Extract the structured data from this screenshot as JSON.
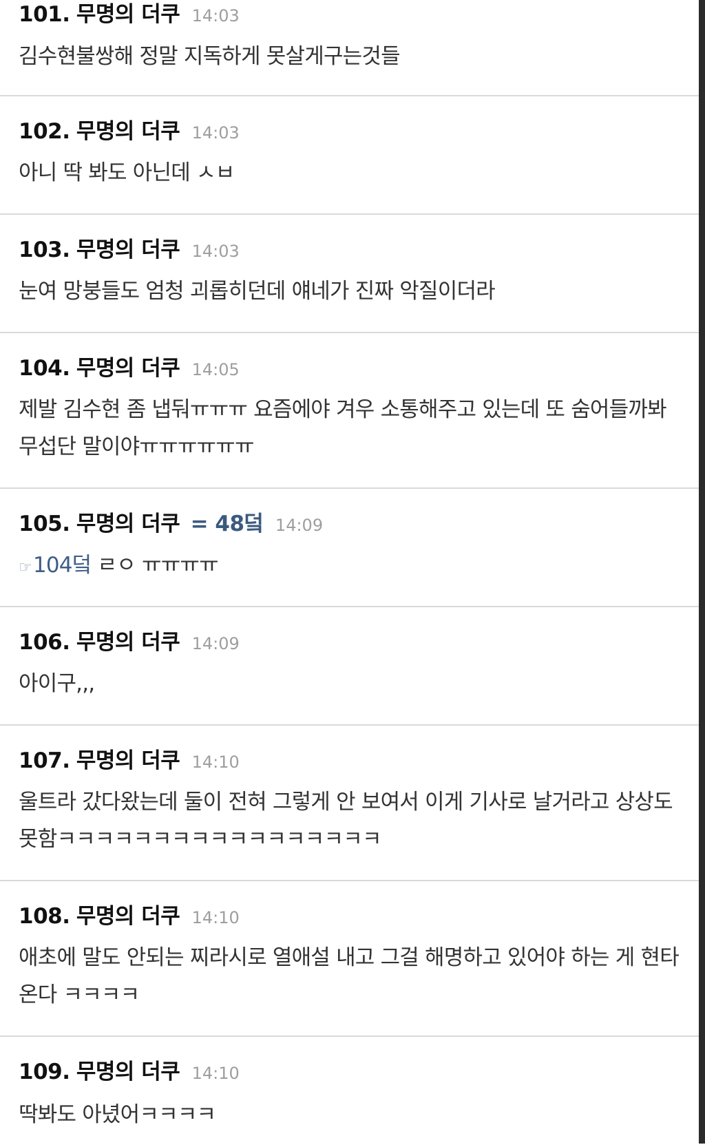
{
  "comments": [
    {
      "number": "101.",
      "author": "무명의 더쿠",
      "time": "14:03",
      "body": "김수현불쌍해 정말 지독하게 못살게구는것들"
    },
    {
      "number": "102.",
      "author": "무명의 더쿠",
      "time": "14:03",
      "body": "아니 딱 봐도 아닌데 ㅅㅂ"
    },
    {
      "number": "103.",
      "author": "무명의 더쿠",
      "time": "14:03",
      "body": "눈여 망붕들도 엄청 괴롭히던데 얘네가 진짜 악질이더라"
    },
    {
      "number": "104.",
      "author": "무명의 더쿠",
      "time": "14:05",
      "body": "제발 김수현 좀 냅둬ㅠㅠㅠ 요즘에야 겨우 소통해주고 있는데 또 숨어들까봐 무섭단 말이야ㅠㅠㅠㅠㅠㅠ"
    },
    {
      "number": "105.",
      "author": "무명의 더쿠",
      "author_tag": "= 48덬",
      "time": "14:09",
      "reply_hand": "☞",
      "reply_ref": "104덬",
      "body": " ㄹㅇ ㅠㅠㅠㅠ"
    },
    {
      "number": "106.",
      "author": "무명의 더쿠",
      "time": "14:09",
      "body": "아이구,,,"
    },
    {
      "number": "107.",
      "author": "무명의 더쿠",
      "time": "14:10",
      "body": "울트라 갔다왔는데 둘이 전혀 그렇게 안 보여서 이게 기사로 날거라고 상상도 못함ㅋㅋㅋㅋㅋㅋㅋㅋㅋㅋㅋㅋㅋㅋㅋㅋㅋ"
    },
    {
      "number": "108.",
      "author": "무명의 더쿠",
      "time": "14:10",
      "body": "애초에 말도 안되는 찌라시로 열애설 내고 그걸 해명하고 있어야 하는 게 현타온다 ㅋㅋㅋㅋ"
    },
    {
      "number": "109.",
      "author": "무명의 더쿠",
      "time": "14:10",
      "body": "딱봐도 아녔어ㅋㅋㅋㅋ"
    }
  ]
}
